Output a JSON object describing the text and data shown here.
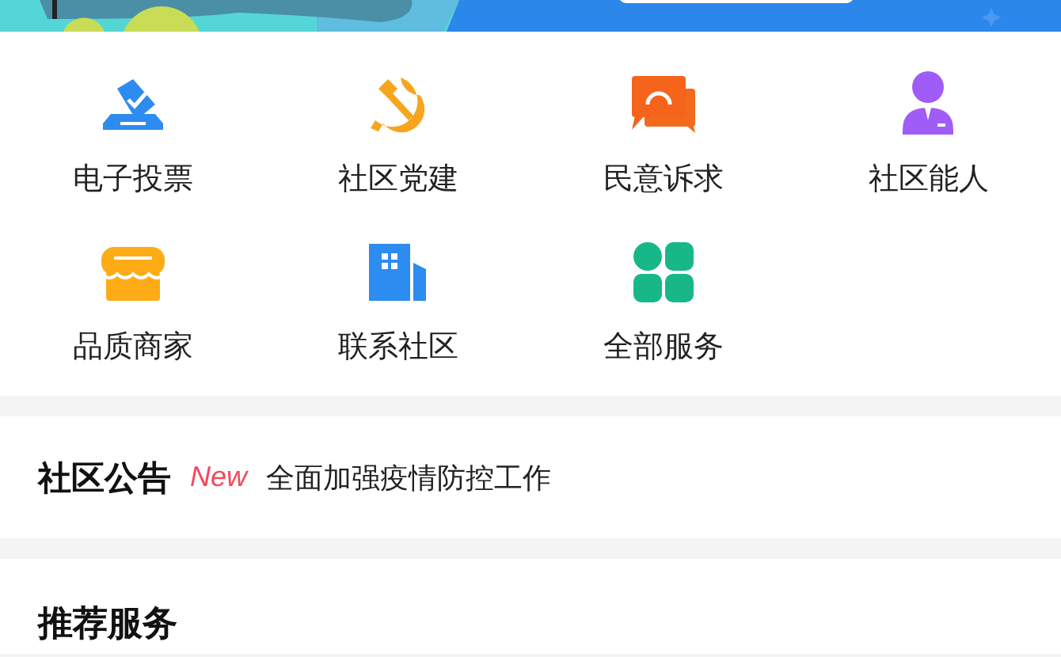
{
  "services": [
    {
      "label": "电子投票",
      "kind": "vote"
    },
    {
      "label": "社区党建",
      "kind": "party"
    },
    {
      "label": "民意诉求",
      "kind": "chat"
    },
    {
      "label": "社区能人",
      "kind": "person"
    },
    {
      "label": "品质商家",
      "kind": "shop"
    },
    {
      "label": "联系社区",
      "kind": "building"
    },
    {
      "label": "全部服务",
      "kind": "grid"
    }
  ],
  "notice": {
    "title": "社区公告",
    "badge": "New",
    "text": "全面加强疫情防控工作"
  },
  "recommend": {
    "title": "推荐服务"
  }
}
